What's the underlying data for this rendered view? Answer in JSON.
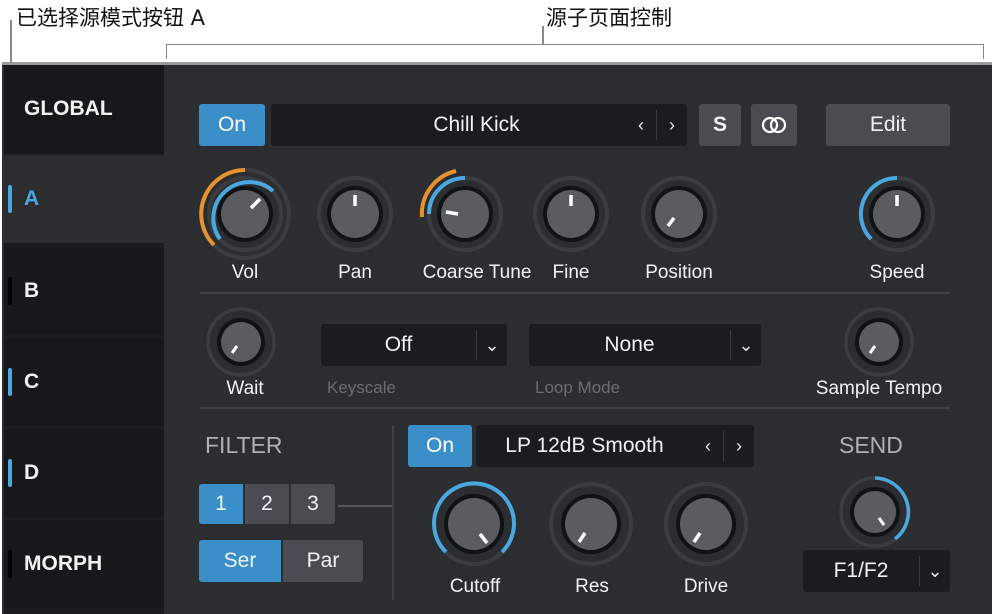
{
  "callouts": {
    "selected_source_mode_button": "已选择源模式按钮 A",
    "source_subpage_controls": "源子页面控制"
  },
  "colors": {
    "accent_blue": "#4aa8df",
    "accent_orange": "#e6922f",
    "panel_bg": "#2b2d31",
    "sidebar_bg": "#1b1c1f"
  },
  "sidebar": {
    "items": [
      {
        "label": "GLOBAL",
        "selected": false,
        "marker": false
      },
      {
        "label": "A",
        "selected": true,
        "marker": true
      },
      {
        "label": "B",
        "selected": false,
        "marker": false
      },
      {
        "label": "C",
        "selected": false,
        "marker": true
      },
      {
        "label": "D",
        "selected": false,
        "marker": true
      },
      {
        "label": "MORPH",
        "selected": false,
        "marker": false
      }
    ]
  },
  "source": {
    "on_label": "On",
    "sample_name": "Chill Kick",
    "prev_icon": "chevron-left",
    "next_icon": "chevron-right",
    "solo_label": "S",
    "link_icon": "linked-rings",
    "edit_label": "Edit"
  },
  "knobs": {
    "vol": "Vol",
    "pan": "Pan",
    "coarse_tune": "Coarse Tune",
    "fine": "Fine",
    "position": "Position",
    "speed": "Speed",
    "wait": "Wait",
    "sample_tempo": "Sample Tempo"
  },
  "keyscale": {
    "value": "Off",
    "label": "Keyscale"
  },
  "loop_mode": {
    "value": "None",
    "label": "Loop Mode"
  },
  "filter": {
    "section_label": "FILTER",
    "filter_numbers": [
      "1",
      "2",
      "3"
    ],
    "selected_filter": "1",
    "routing": [
      "Ser",
      "Par"
    ],
    "selected_routing": "Ser",
    "on_label": "On",
    "type": "LP 12dB Smooth",
    "cutoff": "Cutoff",
    "res": "Res",
    "drive": "Drive"
  },
  "send": {
    "section_label": "SEND",
    "value": "F1/F2"
  }
}
